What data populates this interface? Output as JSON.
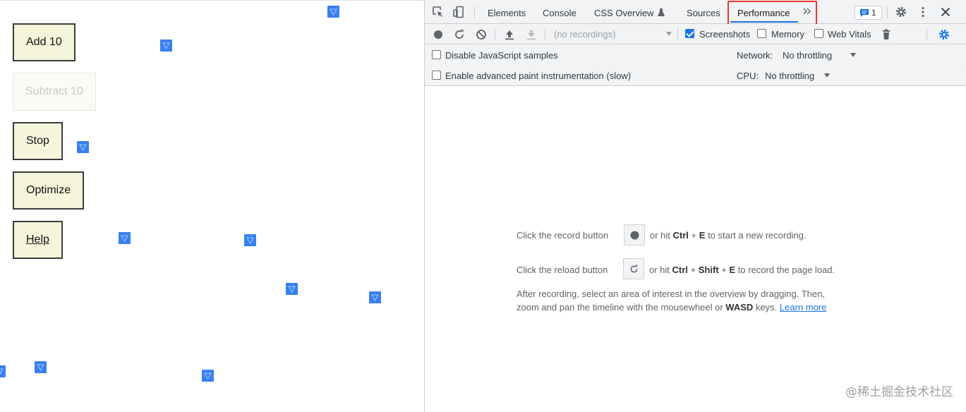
{
  "demo": {
    "buttons": {
      "add": "Add 10",
      "subtract": "Subtract 10",
      "stop": "Stop",
      "optimize": "Optimize",
      "help": "Help"
    },
    "square_color": "#3880f2"
  },
  "devtools": {
    "tabs": {
      "elements": "Elements",
      "console": "Console",
      "css_overview": "CSS Overview",
      "sources": "Sources",
      "performance": "Performance"
    },
    "messages_badge": "1",
    "recordings_select": "(no recordings)",
    "checkboxes": {
      "screenshots": "Screenshots",
      "memory": "Memory",
      "web_vitals": "Web Vitals",
      "disable_js_samples": "Disable JavaScript samples",
      "advanced_paint": "Enable advanced paint instrumentation (slow)"
    },
    "network_label": "Network:",
    "network_value": "No throttling",
    "cpu_label": "CPU:",
    "cpu_value": "No throttling",
    "landing": {
      "record_pre": "Click the record button",
      "record_post_a": "or hit",
      "record_key1": "Ctrl",
      "record_plus": "+",
      "record_key2": "E",
      "record_post_b": "to start a new recording.",
      "reload_pre": "Click the reload button",
      "reload_post_a": "or hit",
      "reload_key1": "Ctrl",
      "reload_key2": "Shift",
      "reload_key3": "E",
      "reload_post_b": "to record the page load.",
      "after_line1": "After recording, select an area of interest in the overview by dragging. Then,",
      "after_line2_a": "zoom and pan the timeline with the mousewheel or",
      "after_key": "WASD",
      "after_line2_b": "keys.",
      "learn_more": "Learn more"
    },
    "accent_color": "#1a73e8",
    "highlight_color": "#e53935"
  },
  "watermark": "@稀土掘金技术社区"
}
